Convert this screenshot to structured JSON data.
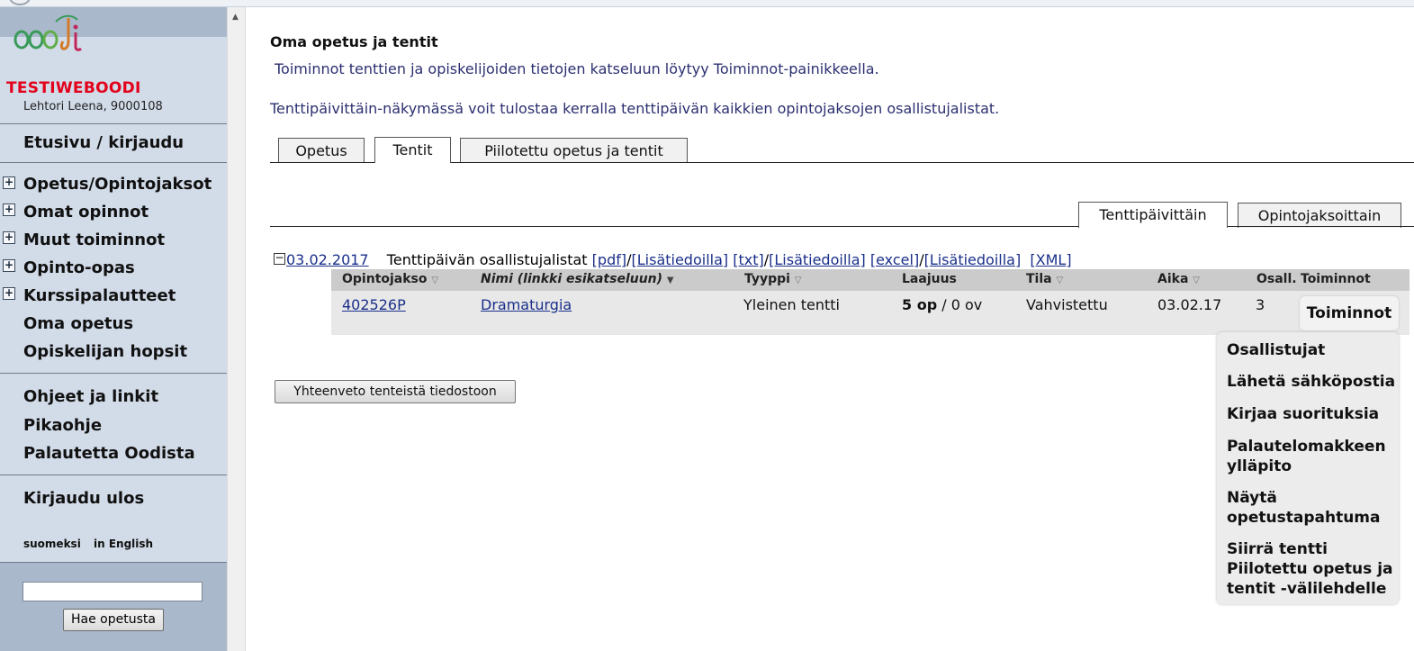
{
  "sidebar": {
    "site_name": "TESTIWEBOODI",
    "user": "Lehtori Leena, 9000108",
    "home": "Etusivu / kirjaudu",
    "expandable": [
      "Opetus/Opintojaksot",
      "Omat opinnot",
      "Muut toiminnot",
      "Opinto-opas",
      "Kurssipalautteet"
    ],
    "links": [
      "Oma opetus",
      "Opiskelijan hopsit"
    ],
    "help": [
      "Ohjeet ja linkit",
      "Pikaohje",
      "Palautetta Oodista"
    ],
    "logout": "Kirjaudu ulos",
    "lang_fi": "suomeksi",
    "lang_en": "in English",
    "search_value": "",
    "search_button": "Hae opetusta"
  },
  "main": {
    "title": "Oma opetus ja tentit",
    "info1": "Toiminnot tenttien ja opiskelijoiden tietojen katseluun löytyy Toiminnot-painikkeella.",
    "info2": "Tenttipäivittäin-näkymässä voit tulostaa kerralla tenttipäivän kaikkien opintojaksojen osallistujalistat.",
    "tabs": [
      "Opetus",
      "Tentit",
      "Piilotettu opetus ja tentit"
    ],
    "active_tab": "Tentit",
    "subtabs": [
      "Tenttipäivittäin",
      "Opintojaksoittain"
    ],
    "active_subtab": "Tenttipäivittäin",
    "date": "03.02.2017",
    "list_label": "Tenttipäivän osallistujalistat",
    "links": {
      "pdf": "[pdf]",
      "txt": "[txt]",
      "excel": "[excel]",
      "extra": "[Lisätiedoilla]",
      "xml": "[XML]",
      "slash": "/"
    },
    "columns": [
      "Opintojakso",
      "Nimi (linkki esikatseluun)",
      "Tyyppi",
      "Laajuus",
      "Tila",
      "Aika",
      "Osall.",
      "Toiminnot"
    ],
    "row": {
      "code": "402526P",
      "name": "Dramaturgia",
      "type": "Yleinen tentti",
      "credits_op": "5 op",
      "credits_sep": "/",
      "credits_ov": "0 ov",
      "status": "Vahvistettu",
      "time": "03.02.17",
      "participants": "3"
    },
    "actions_button": "Toiminnot",
    "actions_menu": [
      "Osallistujat",
      "Lähetä sähköpostia",
      "Kirjaa suorituksia",
      "Palautelomakkeen ylläpito",
      "Näytä opetustapahtuma",
      "Siirrä tentti Piilotettu opetus ja tentit -välilehdelle"
    ],
    "summary_button": "Yhteenveto tenteistä tiedostoon"
  }
}
